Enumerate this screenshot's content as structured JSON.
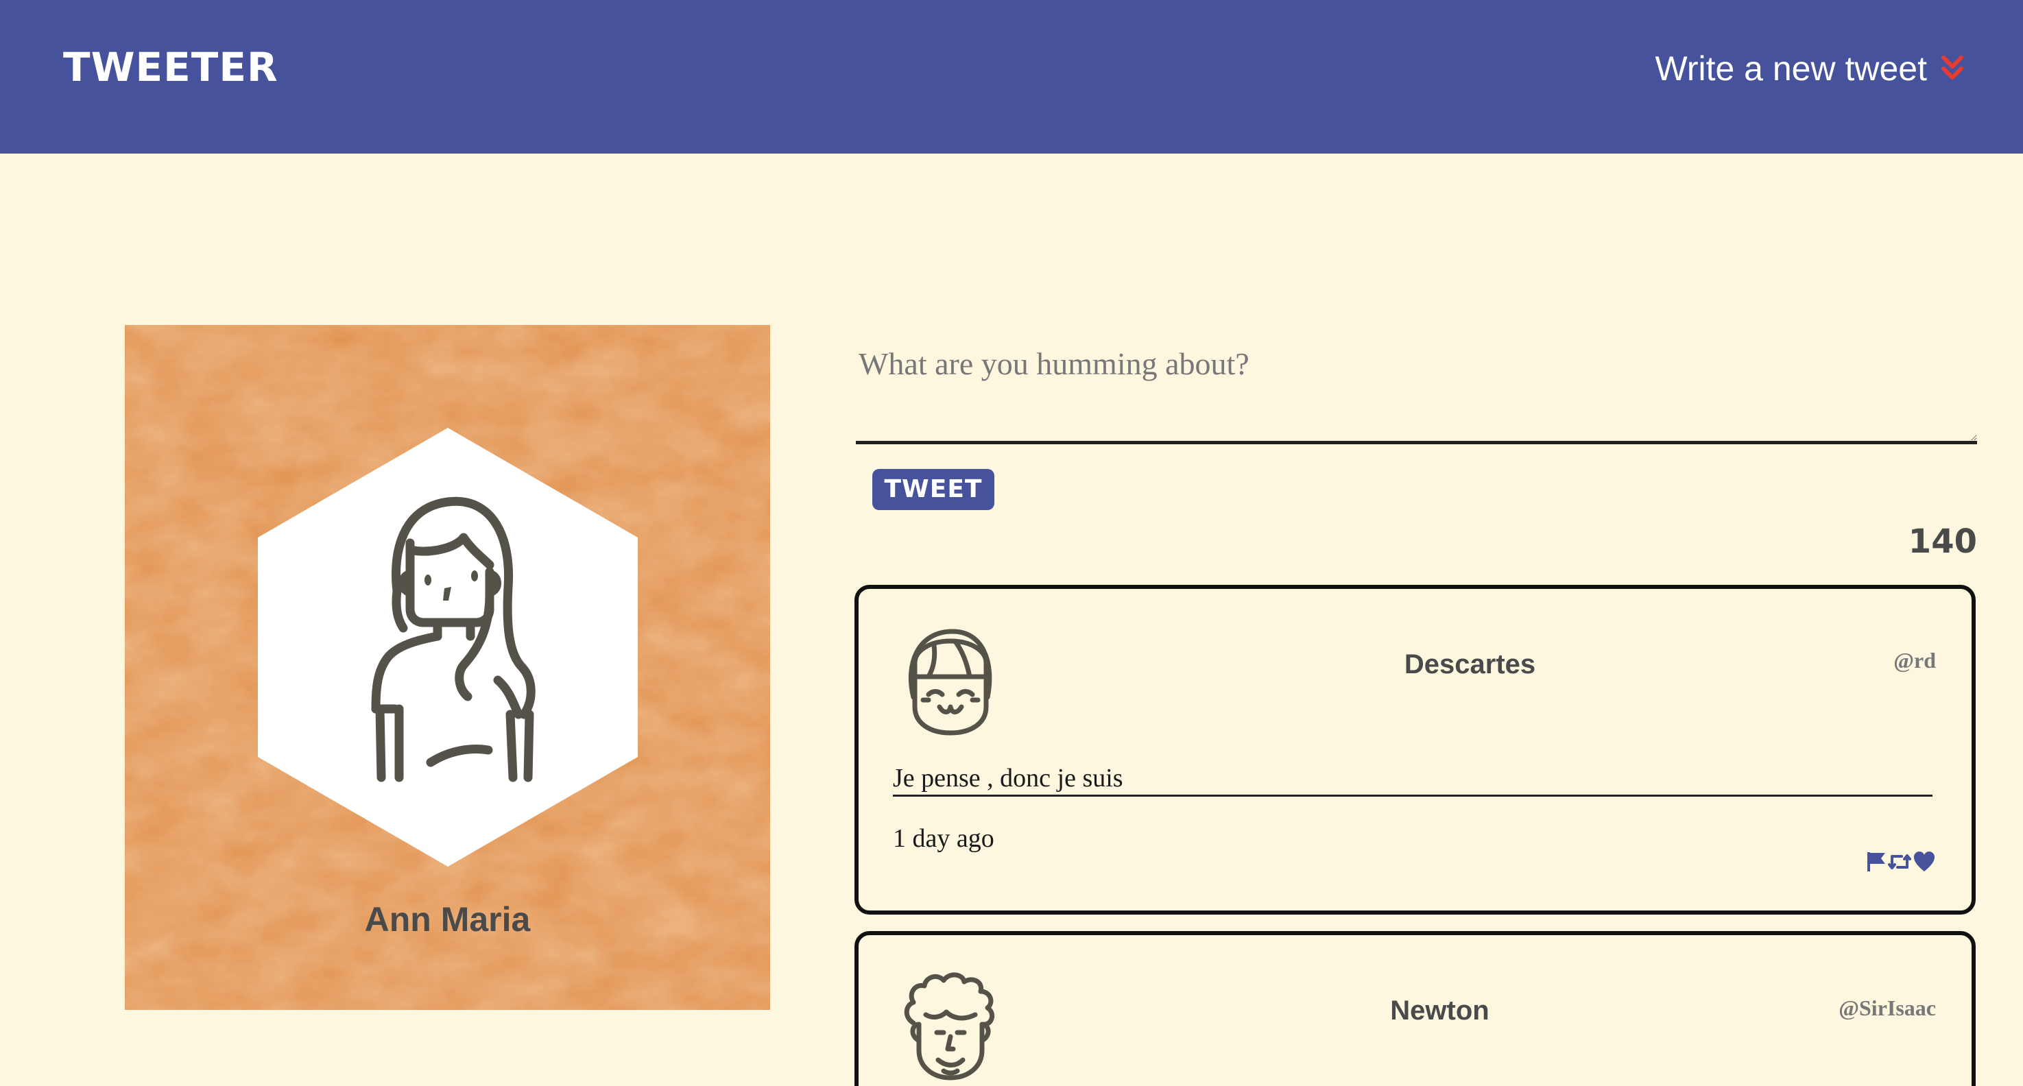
{
  "nav": {
    "brand": "TWEETER",
    "compose_label": "Write a new tweet",
    "compose_icon": "double-chevron-down-icon",
    "compose_icon_color": "#e63c2f",
    "bg_color": "#46539c"
  },
  "profile": {
    "name": "Ann Maria",
    "avatar_icon": "woman-avatar-icon",
    "card_color": "#e29554"
  },
  "composer": {
    "placeholder": "What are you humming about?",
    "value": "",
    "submit_label": "TWEET",
    "char_counter": "140"
  },
  "tweets": [
    {
      "name": "Descartes",
      "handle": "@rd",
      "avatar_icon": "smiling-girl-avatar-icon",
      "content": "Je pense , donc je suis",
      "time": "1 day ago",
      "actions": [
        "flag-icon",
        "retweet-icon",
        "heart-icon"
      ]
    },
    {
      "name": "Newton",
      "handle": "@SirIsaac",
      "avatar_icon": "curly-hair-man-avatar-icon"
    }
  ],
  "colors": {
    "page_bg": "#fdf7df",
    "accent": "#46539c",
    "text": "#4a4a4a"
  }
}
